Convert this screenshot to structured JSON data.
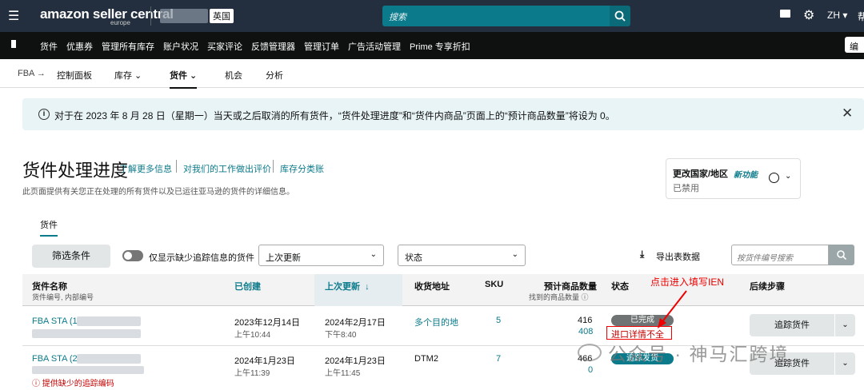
{
  "topbar": {
    "menu_icon": "hamburger-icon",
    "logo": "amazon seller central",
    "logo_region": "europe",
    "account_region": "英国",
    "search_placeholder": "搜索",
    "language": "ZH",
    "help": "帮"
  },
  "navbar": {
    "items": [
      "货件",
      "优惠券",
      "管理所有库存",
      "账户状况",
      "买家评论",
      "反馈管理器",
      "管理订单",
      "广告活动管理",
      "Prime 专享折扣"
    ],
    "edit": "编"
  },
  "subnav": {
    "root": "FBA",
    "arrow": "→",
    "items": [
      "控制面板",
      "库存",
      "货件",
      "机会",
      "分析"
    ],
    "active": "货件"
  },
  "banner": {
    "text": "对于在 2023 年 8 月 28 日（星期一）当天或之后取消的所有货件，“货件处理进度”和“货件内商品”页面上的“预计商品数量”将设为 0。"
  },
  "header": {
    "title": "货件处理进度",
    "links": [
      "了解更多信息",
      "对我们的工作做出评价",
      "库存分类账"
    ],
    "description": "此页面提供有关您正在处理的所有货件以及已运往亚马逊的货件的详细信息。"
  },
  "country": {
    "label": "更改国家/地区",
    "new_feature": "新功能",
    "status": "已禁用"
  },
  "tab": "货件",
  "filters": {
    "filter_button": "筛选条件",
    "toggle_label": "仅显示缺少追踪信息的货件",
    "sort_select": "上次更新",
    "status_select": "状态",
    "export": "导出表数据",
    "search_placeholder": "按货件编号搜索"
  },
  "table": {
    "columns": {
      "name": "货件名称",
      "name_sub": "货件编号, 内部编号",
      "created": "已创建",
      "updated": "上次更新",
      "destination": "收货地址",
      "sku": "SKU",
      "qty": "预计商品数量",
      "qty_sub": "找到的商品数量",
      "status": "状态",
      "next": "后续步骤"
    },
    "rows": [
      {
        "name": "FBA STA (14",
        "created_date": "2023年12月14日",
        "created_time": "上午10:44",
        "updated_date": "2024年2月17日",
        "updated_time": "下午8:40",
        "destination": "多个目的地",
        "sku": "5",
        "qty_expected": "416",
        "qty_found": "408",
        "status": "已完成",
        "status_note": "进口详情不全",
        "action": "追踪货件"
      },
      {
        "name": "FBA STA (2",
        "created_date": "2024年1月23日",
        "created_time": "上午11:39",
        "updated_date": "2024年1月23日",
        "updated_time": "上午11:45",
        "destination": "DTM2",
        "sku": "7",
        "qty_expected": "466",
        "qty_found": "0",
        "status": "追踪发货",
        "warning": "提供缺少的追踪编码",
        "action": "追踪货件"
      }
    ]
  },
  "annotation": {
    "text": "点击进入填写IEN",
    "color": "#e00000"
  },
  "watermark": "公众号 · 神马汇跨境"
}
